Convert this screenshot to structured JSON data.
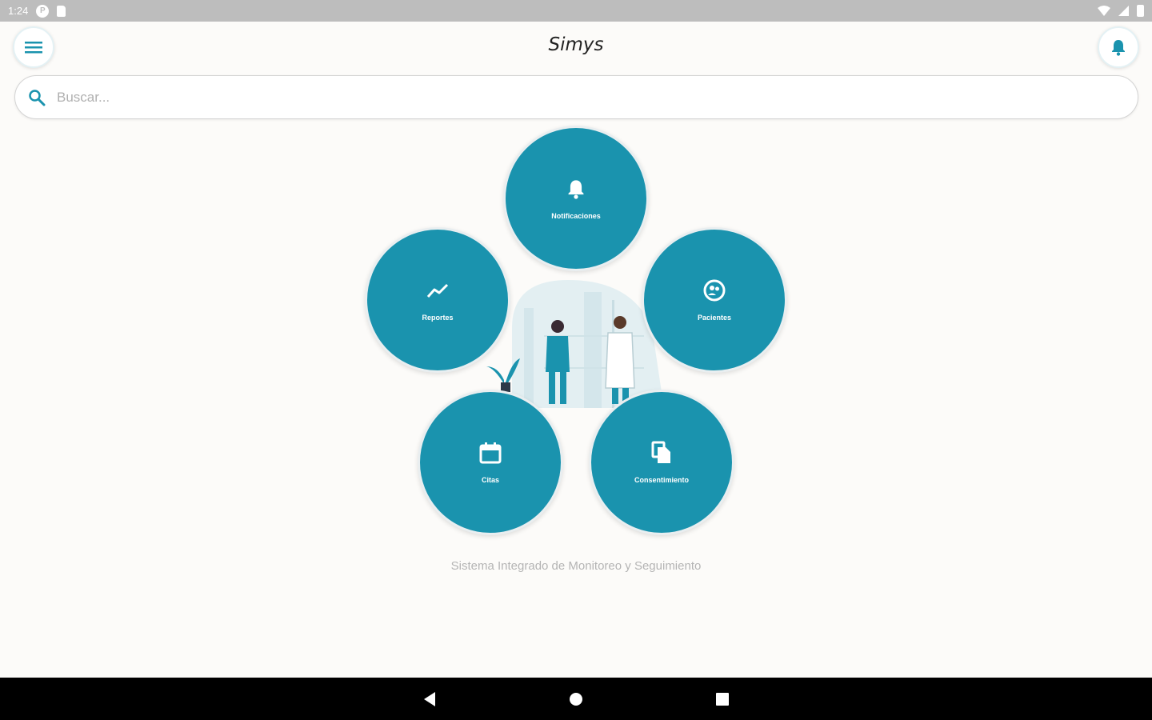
{
  "status_bar": {
    "time": "1:24",
    "badge": "P"
  },
  "app_bar": {
    "title": "Simys"
  },
  "search": {
    "placeholder": "Buscar..."
  },
  "menu_items": [
    {
      "label": "Notificaciones",
      "icon": "bell-icon"
    },
    {
      "label": "Reportes",
      "icon": "trend-icon"
    },
    {
      "label": "Pacientes",
      "icon": "patients-icon"
    },
    {
      "label": "Citas",
      "icon": "calendar-icon"
    },
    {
      "label": "Consentimiento",
      "icon": "documents-icon"
    }
  ],
  "footer": {
    "subtitle": "Sistema Integrado de Monitoreo y Seguimiento"
  },
  "colors": {
    "primary": "#1a93ae",
    "background": "#fcfbf9",
    "status_bar": "#bdbdbd"
  }
}
